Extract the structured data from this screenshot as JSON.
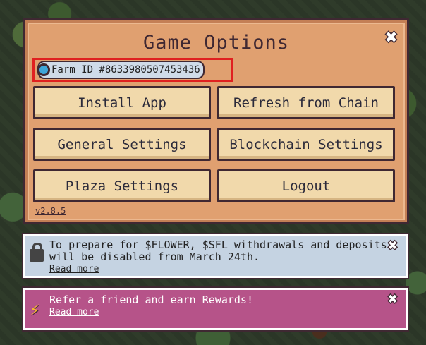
{
  "dialog": {
    "title": "Game Options",
    "farm_id": "Farm ID #8633980507453436",
    "buttons": {
      "install_app": "Install App",
      "refresh_from_chain": "Refresh from Chain",
      "general_settings": "General Settings",
      "blockchain_settings": "Blockchain Settings",
      "plaza_settings": "Plaza Settings",
      "logout": "Logout"
    },
    "version": "v2.8.5",
    "close_glyph": "✖"
  },
  "banners": [
    {
      "text": "To prepare for $FLOWER, $SFL withdrawals and deposits will be disabled from March 24th.",
      "link": "Read more",
      "icon": "lock-icon",
      "close_glyph": "✖"
    },
    {
      "text": "Refer a friend and earn Rewards!",
      "link": "Read more",
      "icon": "lightning-icon",
      "icon_glyph": "⚡",
      "close_glyph": "✖"
    }
  ],
  "colors": {
    "panel": "#e0a070",
    "button": "#f1d9ab",
    "border": "#3f2832",
    "highlight": "#e02020",
    "banner_info": "#c5d3e2",
    "banner_referral": "#b65389"
  }
}
